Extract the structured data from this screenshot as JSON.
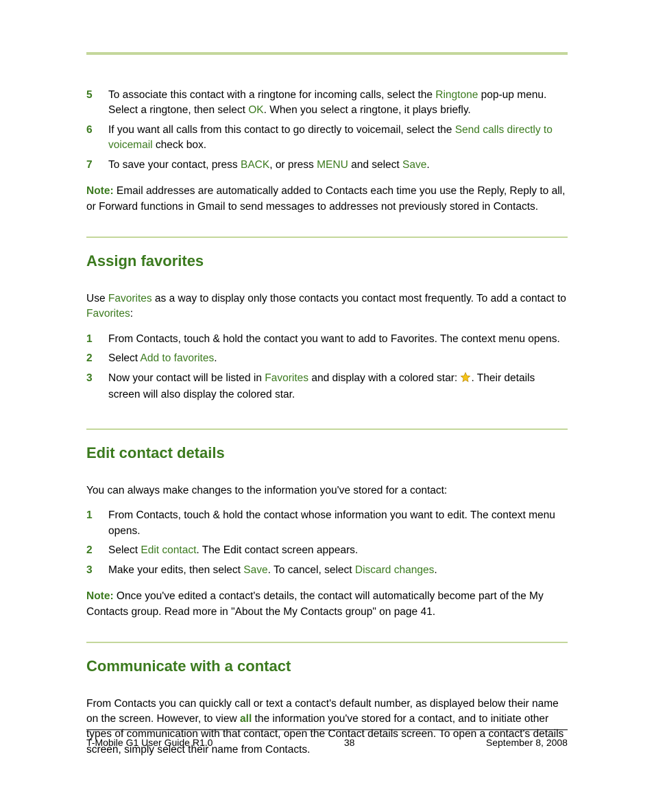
{
  "step5": {
    "num": "5",
    "t1": "To associate this contact with a ringtone for incoming calls, select the ",
    "k1": "Ringtone",
    "t2": " pop-up menu. Select a ringtone, then select ",
    "k2": "OK",
    "t3": ". When you select a ringtone, it plays briefly."
  },
  "step6": {
    "num": "6",
    "t1": "If you want all calls from this contact to go directly to voicemail, select the ",
    "k1": "Send calls directly to voicemail",
    "t2": " check box."
  },
  "step7": {
    "num": "7",
    "t1": "To save your contact, press ",
    "k1": "BACK",
    "t2": ", or press ",
    "k2": "MENU",
    "t3": " and select ",
    "k3": "Save",
    "t4": "."
  },
  "note1": {
    "label": "Note:",
    "text": " Email addresses are automatically added to Contacts each time you use the Reply, Reply to all, or Forward functions in Gmail to send messages to addresses not previously stored in Contacts."
  },
  "sec1": {
    "heading": "Assign favorites",
    "intro_t1": "Use ",
    "intro_k1": "Favorites",
    "intro_t2": " as a way to display only those contacts you contact most frequently. To add a contact to ",
    "intro_k2": "Favorites",
    "intro_t3": ":",
    "s1": {
      "num": "1",
      "t1": "From Contacts, touch & hold the contact you want to add to Favorites. The context menu opens."
    },
    "s2": {
      "num": "2",
      "t1": "Select ",
      "k1": "Add to favorites",
      "t2": "."
    },
    "s3": {
      "num": "3",
      "t1": "Now your contact will be listed in ",
      "k1": "Favorites",
      "t2": " and display with a colored star: ",
      "t3": ". Their details screen will also display the colored star."
    }
  },
  "sec2": {
    "heading": "Edit contact details",
    "intro": "You can always make changes to the information you've stored for a contact:",
    "s1": {
      "num": "1",
      "t1": "From Contacts, touch & hold the contact whose information you want to edit. The context menu opens."
    },
    "s2": {
      "num": "2",
      "t1": "Select ",
      "k1": "Edit contact",
      "t2": ". The Edit contact screen appears."
    },
    "s3": {
      "num": "3",
      "t1": "Make your edits, then select ",
      "k1": "Save",
      "t2": ". To cancel, select ",
      "k2": "Discard changes",
      "t3": "."
    },
    "note": {
      "label": "Note:",
      "text": " Once you've edited a contact's details, the contact will automatically become part of the My Contacts group. Read more in \"About the My Contacts group\" on page 41."
    }
  },
  "sec3": {
    "heading": "Communicate with a contact",
    "p_t1": "From Contacts you can quickly call or text a contact's default number, as displayed below their name on the screen. However, to view ",
    "p_k1": "all",
    "p_t2": " the information you've stored for a contact, and to initiate other types of communication with that contact, open the Contact details screen. To open a contact's details screen, simply select their name from Contacts."
  },
  "footer": {
    "left": "T-Mobile G1 User Guide R1.0",
    "center": "38",
    "right": "September 8, 2008"
  }
}
